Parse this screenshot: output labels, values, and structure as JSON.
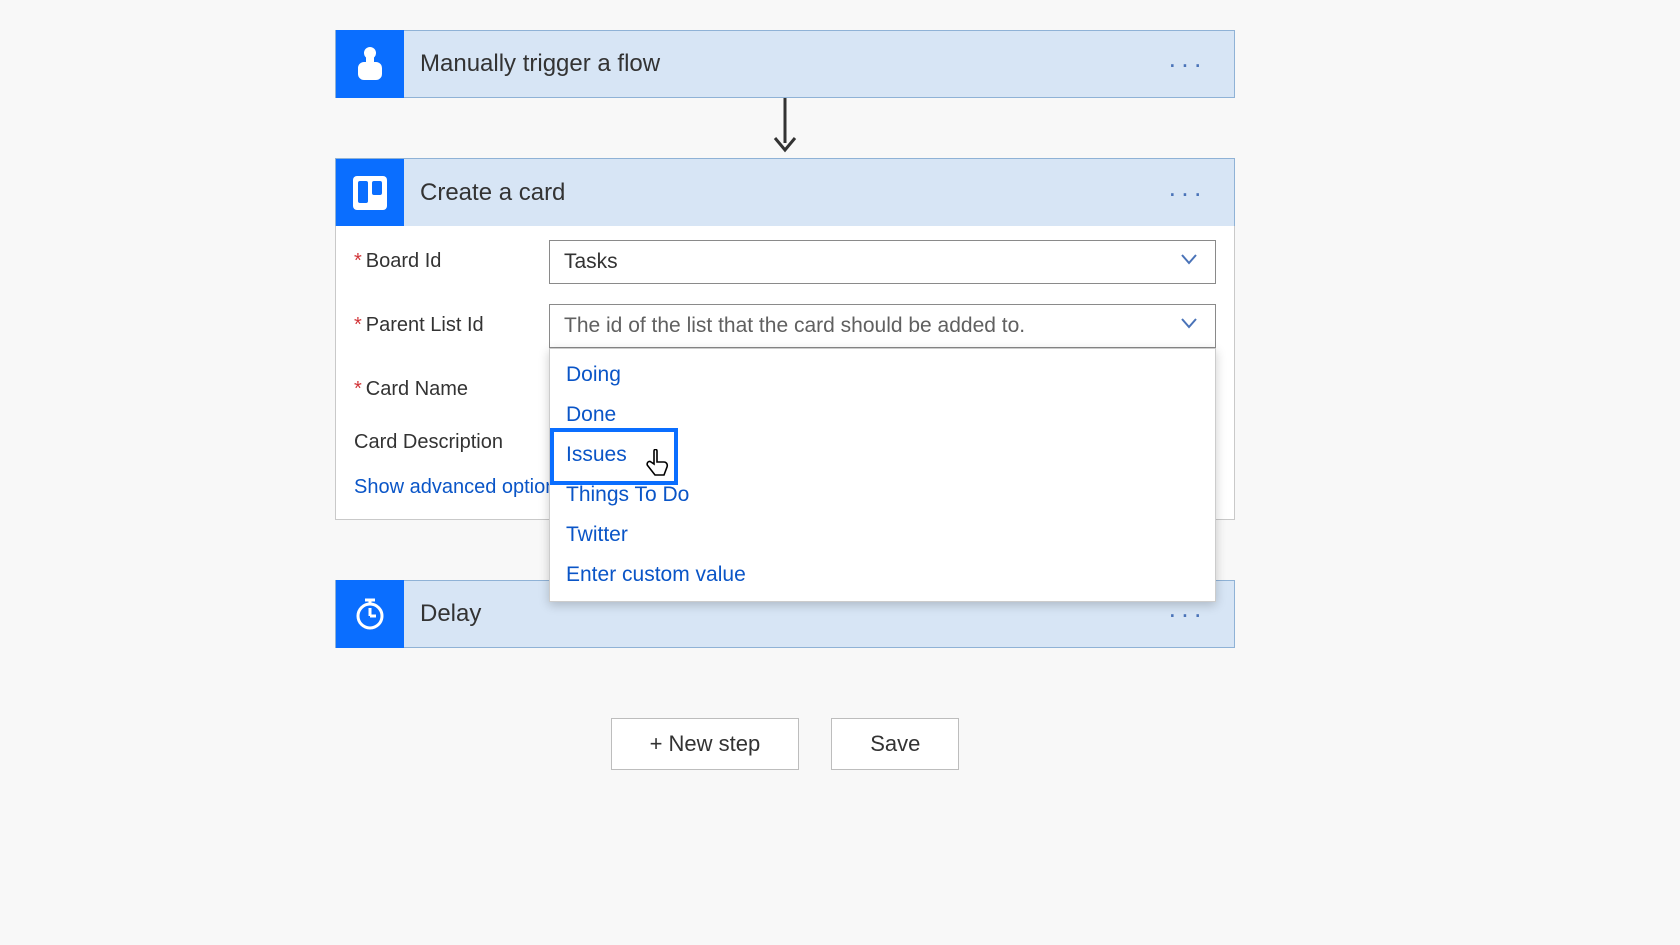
{
  "steps": {
    "trigger": {
      "title": "Manually trigger a flow"
    },
    "create_card": {
      "title": "Create a card",
      "fields": {
        "board_id": {
          "label": "Board Id",
          "value": "Tasks",
          "required": true
        },
        "parent_list": {
          "label": "Parent List Id",
          "placeholder": "The id of the list that the card should be added to.",
          "required": true
        },
        "card_name": {
          "label": "Card Name",
          "required": true
        },
        "card_desc": {
          "label": "Card Description",
          "required": false
        }
      },
      "adv_link": "Show advanced options",
      "dropdown_options": [
        "Doing",
        "Done",
        "Issues",
        "Things To Do",
        "Twitter",
        "Enter custom value"
      ],
      "highlighted_option": "Issues"
    },
    "delay": {
      "title": "Delay"
    }
  },
  "footer": {
    "new_step": "+ New step",
    "save": "Save"
  }
}
